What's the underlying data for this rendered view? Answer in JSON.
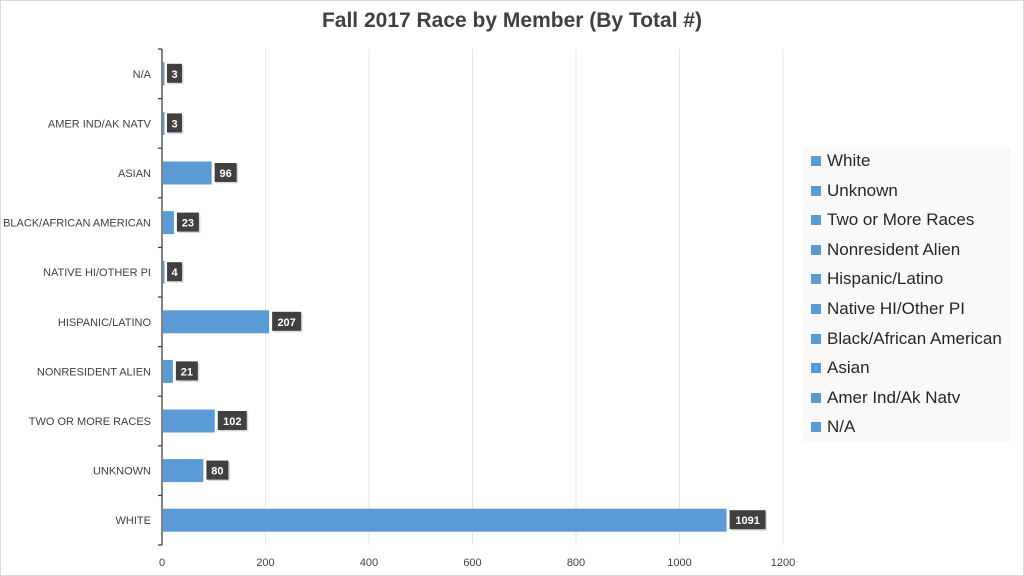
{
  "chart_data": {
    "type": "bar",
    "orientation": "horizontal",
    "title": "Fall 2017 Race by Member (By Total #)",
    "xlabel": "",
    "ylabel": "",
    "categories": [
      "N/A",
      "AMER IND/AK NATV",
      "ASIAN",
      "BLACK/AFRICAN AMERICAN",
      "NATIVE HI/OTHER PI",
      "HISPANIC/LATINO",
      "NONRESIDENT ALIEN",
      "TWO OR MORE RACES",
      "UNKNOWN",
      "WHITE"
    ],
    "values": [
      3,
      3,
      96,
      23,
      4,
      207,
      21,
      102,
      80,
      1091
    ],
    "data_labels": [
      "3",
      "3",
      "96",
      "23",
      "4",
      "207",
      "21",
      "102",
      "80",
      "1091"
    ],
    "xlim": [
      0,
      1200
    ],
    "x_ticks": [
      0,
      200,
      400,
      600,
      800,
      1000,
      1200
    ],
    "x_tick_labels": [
      "0",
      "200",
      "400",
      "600",
      "800",
      "1000",
      "1200"
    ],
    "grid": "vertical",
    "legend": {
      "placement": "right",
      "entries": [
        "White",
        "Unknown",
        "Two or More Races",
        "Nonresident Alien",
        "Hispanic/Latino",
        "Native HI/Other PI",
        "Black/African American",
        "Asian",
        "Amer Ind/Ak Natv",
        "N/A"
      ]
    },
    "colors": {
      "bar": "#5b9bd5",
      "data_label_bg": "#404040",
      "data_label_text": "#ffffff",
      "gridline": "#e6e6e6",
      "axis": "#404040"
    }
  }
}
